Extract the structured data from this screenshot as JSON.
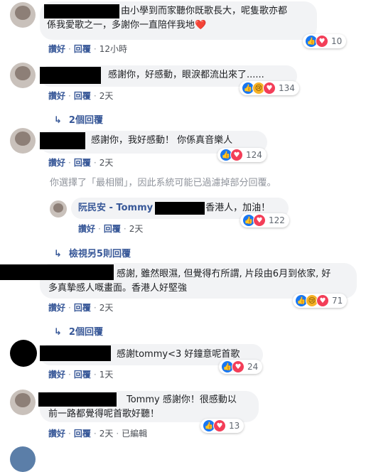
{
  "actions": {
    "like": "讚好",
    "reply": "回覆",
    "edited": "已編輯"
  },
  "comments": [
    {
      "text": "由小學到而家聽你既歌長大，呢隻歌亦都係我愛歌之一，多謝你一直陪伴我地",
      "heart": "❤️",
      "time": "12小時",
      "reaction_count": "10"
    },
    {
      "text": "感謝你，好感動，眼淚都流出來了......",
      "time": "2天",
      "reaction_count": "134",
      "replies_label": "2個回覆"
    },
    {
      "text": "感謝你，我好感動！ 你係真音樂人",
      "time": "2天",
      "reaction_count": "124"
    },
    {
      "text": "感謝, 雖然眼濕, 但覺得冇所謂, 片段由6月到依家, 好多真摯感人嘅畫面。香港人好堅強",
      "time": "2天",
      "reaction_count": "71",
      "replies_label": "2個回覆"
    },
    {
      "text": "感謝tommy<3 好鐘意呢首歌",
      "time": "1天",
      "reaction_count": "24"
    },
    {
      "text": "Tommy 感謝你！很感動以前一路都覺得呢首歌好聽！",
      "time": "2天",
      "reaction_count": "13"
    }
  ],
  "filter_notice": "你選擇了「最相關」，因此系統可能已過濾掉部分回覆。",
  "reply": {
    "name": "阮民安 - Tommy",
    "text": "香港人，加油！",
    "time": "2天",
    "reaction_count": "122"
  },
  "view_more": "檢視另5則回覆",
  "colors": {
    "link": "#385898",
    "bubble": "#f2f3f5",
    "like": "#1877f2",
    "love": "#f33e58",
    "sad": "#f7b125"
  }
}
